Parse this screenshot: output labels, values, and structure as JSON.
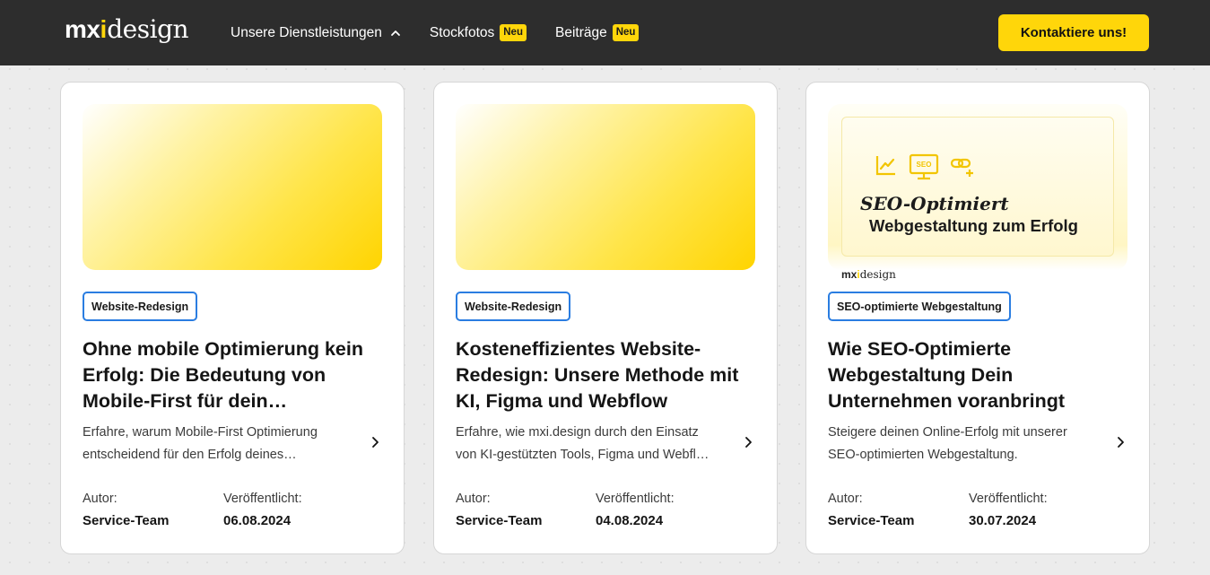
{
  "header": {
    "logo": {
      "mx": "mx",
      "dot": "i",
      "design": "design"
    },
    "nav": [
      {
        "label": "Unsere Dienstleistungen",
        "icon": "chevron-up-icon"
      },
      {
        "label": "Stockfotos",
        "badge": "Neu"
      },
      {
        "label": "Beiträge",
        "badge": "Neu"
      }
    ],
    "cta_label": "Kontaktiere uns!"
  },
  "colors": {
    "accent": "#ffd60a",
    "header_bg": "#2d2d2d",
    "tag_border": "#2a7de1"
  },
  "cards": [
    {
      "tag": "Website-Redesign",
      "title": "Ohne mobile Optimierung kein Erfolg: Die Bedeutung von Mobile-First für dein Unternehmen",
      "excerpt": "Erfahre, warum Mobile-First Optimierung entscheidend für den Erfolg deines Unternehmens ist.",
      "author_label": "Autor:",
      "author": "Service-Team",
      "published_label": "Veröffentlicht:",
      "date": "06.08.2024"
    },
    {
      "tag": "Website-Redesign",
      "title": "Kosteneffizientes Website-Redesign: Unsere Methode mit KI, Figma und Webflow",
      "excerpt": "Erfahre, wie mxi.design durch den Einsatz von KI-gestützten Tools, Figma und Webflow arbeitet.",
      "author_label": "Autor:",
      "author": "Service-Team",
      "published_label": "Veröffentlicht:",
      "date": "04.08.2024"
    },
    {
      "tag": "SEO-optimierte Webgestaltung",
      "title": "Wie SEO-Optimierte Webgestaltung Dein Unternehmen voranbringt",
      "excerpt": "Steigere deinen Online-Erfolg mit unserer SEO-optimierten Webgestaltung.",
      "author_label": "Autor:",
      "author": "Service-Team",
      "published_label": "Veröffentlicht:",
      "date": "30.07.2024",
      "thumb": {
        "title_line1": "SEO-Optimiert",
        "title_line2": "Webgestaltung zum Erfolg",
        "seo_icon_label": "SEO",
        "logo_mx": "mx",
        "logo_dot": "i",
        "logo_design": "design"
      }
    }
  ]
}
